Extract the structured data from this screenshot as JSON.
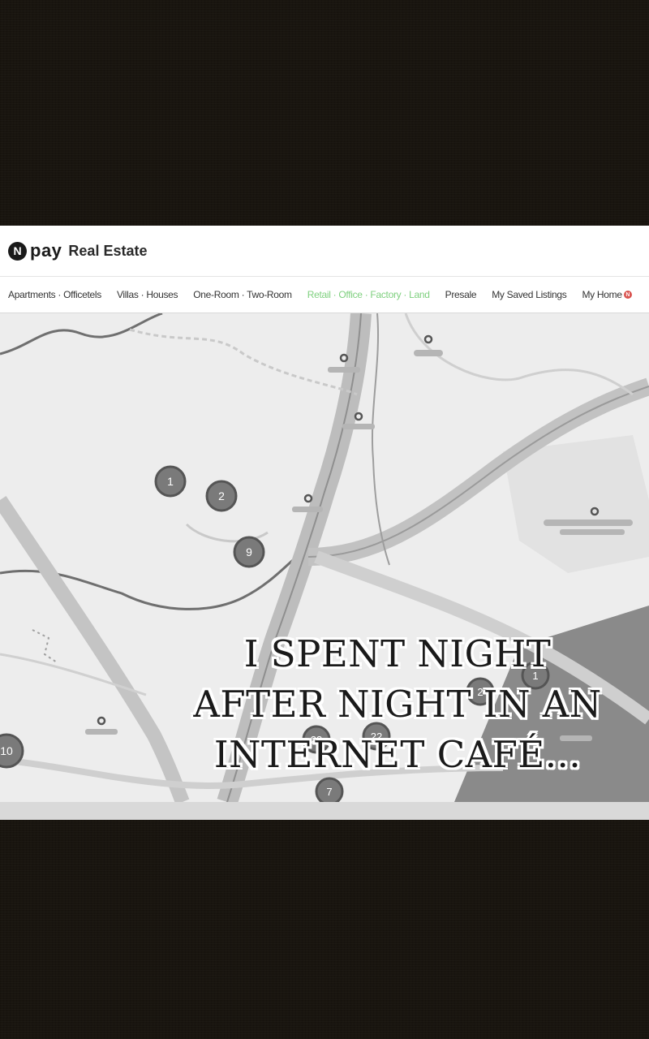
{
  "header": {
    "logo_badge": "N",
    "logo_pay": "pay",
    "logo_title": "Real Estate"
  },
  "nav": {
    "items": [
      {
        "label": "Apartments · Officetels",
        "active": false
      },
      {
        "label": "Villas · Houses",
        "active": false
      },
      {
        "label": "One-Room · Two-Room",
        "active": false
      },
      {
        "label": "Retail · Office · Factory · Land",
        "active": true
      },
      {
        "label": "Presale",
        "active": false
      },
      {
        "label": "My Saved Listings",
        "active": false
      }
    ],
    "my_home": "My Home",
    "my_home_badge": "N",
    "active_color": "#7fd07f"
  },
  "map": {
    "clusters": [
      "1",
      "2",
      "9",
      "10",
      "23",
      "22",
      "1",
      "2",
      "7"
    ]
  },
  "caption": {
    "line1": "I SPENT NIGHT",
    "line2": "AFTER NIGHT IN AN",
    "line3": "INTERNET CAFÉ..."
  }
}
